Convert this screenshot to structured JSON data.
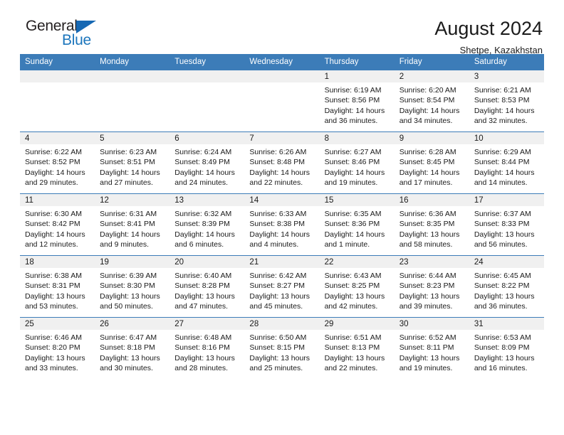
{
  "brand": {
    "name_part1": "General",
    "name_part2": "Blue",
    "triangle_color": "#1668b3",
    "blue_color": "#1b75bc"
  },
  "header": {
    "title": "August 2024",
    "subtitle": "Shetpe, Kazakhstan"
  },
  "theme": {
    "header_row_bg": "#3c7cb8",
    "daynum_band_bg": "#f0f0f0",
    "rule_color": "#3c7cb8"
  },
  "weekdays": [
    "Sunday",
    "Monday",
    "Tuesday",
    "Wednesday",
    "Thursday",
    "Friday",
    "Saturday"
  ],
  "weeks": [
    [
      {
        "day": "",
        "empty": true
      },
      {
        "day": "",
        "empty": true
      },
      {
        "day": "",
        "empty": true
      },
      {
        "day": "",
        "empty": true
      },
      {
        "day": "1",
        "sunrise": "Sunrise: 6:19 AM",
        "sunset": "Sunset: 8:56 PM",
        "daylight": "Daylight: 14 hours and 36 minutes."
      },
      {
        "day": "2",
        "sunrise": "Sunrise: 6:20 AM",
        "sunset": "Sunset: 8:54 PM",
        "daylight": "Daylight: 14 hours and 34 minutes."
      },
      {
        "day": "3",
        "sunrise": "Sunrise: 6:21 AM",
        "sunset": "Sunset: 8:53 PM",
        "daylight": "Daylight: 14 hours and 32 minutes."
      }
    ],
    [
      {
        "day": "4",
        "sunrise": "Sunrise: 6:22 AM",
        "sunset": "Sunset: 8:52 PM",
        "daylight": "Daylight: 14 hours and 29 minutes."
      },
      {
        "day": "5",
        "sunrise": "Sunrise: 6:23 AM",
        "sunset": "Sunset: 8:51 PM",
        "daylight": "Daylight: 14 hours and 27 minutes."
      },
      {
        "day": "6",
        "sunrise": "Sunrise: 6:24 AM",
        "sunset": "Sunset: 8:49 PM",
        "daylight": "Daylight: 14 hours and 24 minutes."
      },
      {
        "day": "7",
        "sunrise": "Sunrise: 6:26 AM",
        "sunset": "Sunset: 8:48 PM",
        "daylight": "Daylight: 14 hours and 22 minutes."
      },
      {
        "day": "8",
        "sunrise": "Sunrise: 6:27 AM",
        "sunset": "Sunset: 8:46 PM",
        "daylight": "Daylight: 14 hours and 19 minutes."
      },
      {
        "day": "9",
        "sunrise": "Sunrise: 6:28 AM",
        "sunset": "Sunset: 8:45 PM",
        "daylight": "Daylight: 14 hours and 17 minutes."
      },
      {
        "day": "10",
        "sunrise": "Sunrise: 6:29 AM",
        "sunset": "Sunset: 8:44 PM",
        "daylight": "Daylight: 14 hours and 14 minutes."
      }
    ],
    [
      {
        "day": "11",
        "sunrise": "Sunrise: 6:30 AM",
        "sunset": "Sunset: 8:42 PM",
        "daylight": "Daylight: 14 hours and 12 minutes."
      },
      {
        "day": "12",
        "sunrise": "Sunrise: 6:31 AM",
        "sunset": "Sunset: 8:41 PM",
        "daylight": "Daylight: 14 hours and 9 minutes."
      },
      {
        "day": "13",
        "sunrise": "Sunrise: 6:32 AM",
        "sunset": "Sunset: 8:39 PM",
        "daylight": "Daylight: 14 hours and 6 minutes."
      },
      {
        "day": "14",
        "sunrise": "Sunrise: 6:33 AM",
        "sunset": "Sunset: 8:38 PM",
        "daylight": "Daylight: 14 hours and 4 minutes."
      },
      {
        "day": "15",
        "sunrise": "Sunrise: 6:35 AM",
        "sunset": "Sunset: 8:36 PM",
        "daylight": "Daylight: 14 hours and 1 minute."
      },
      {
        "day": "16",
        "sunrise": "Sunrise: 6:36 AM",
        "sunset": "Sunset: 8:35 PM",
        "daylight": "Daylight: 13 hours and 58 minutes."
      },
      {
        "day": "17",
        "sunrise": "Sunrise: 6:37 AM",
        "sunset": "Sunset: 8:33 PM",
        "daylight": "Daylight: 13 hours and 56 minutes."
      }
    ],
    [
      {
        "day": "18",
        "sunrise": "Sunrise: 6:38 AM",
        "sunset": "Sunset: 8:31 PM",
        "daylight": "Daylight: 13 hours and 53 minutes."
      },
      {
        "day": "19",
        "sunrise": "Sunrise: 6:39 AM",
        "sunset": "Sunset: 8:30 PM",
        "daylight": "Daylight: 13 hours and 50 minutes."
      },
      {
        "day": "20",
        "sunrise": "Sunrise: 6:40 AM",
        "sunset": "Sunset: 8:28 PM",
        "daylight": "Daylight: 13 hours and 47 minutes."
      },
      {
        "day": "21",
        "sunrise": "Sunrise: 6:42 AM",
        "sunset": "Sunset: 8:27 PM",
        "daylight": "Daylight: 13 hours and 45 minutes."
      },
      {
        "day": "22",
        "sunrise": "Sunrise: 6:43 AM",
        "sunset": "Sunset: 8:25 PM",
        "daylight": "Daylight: 13 hours and 42 minutes."
      },
      {
        "day": "23",
        "sunrise": "Sunrise: 6:44 AM",
        "sunset": "Sunset: 8:23 PM",
        "daylight": "Daylight: 13 hours and 39 minutes."
      },
      {
        "day": "24",
        "sunrise": "Sunrise: 6:45 AM",
        "sunset": "Sunset: 8:22 PM",
        "daylight": "Daylight: 13 hours and 36 minutes."
      }
    ],
    [
      {
        "day": "25",
        "sunrise": "Sunrise: 6:46 AM",
        "sunset": "Sunset: 8:20 PM",
        "daylight": "Daylight: 13 hours and 33 minutes."
      },
      {
        "day": "26",
        "sunrise": "Sunrise: 6:47 AM",
        "sunset": "Sunset: 8:18 PM",
        "daylight": "Daylight: 13 hours and 30 minutes."
      },
      {
        "day": "27",
        "sunrise": "Sunrise: 6:48 AM",
        "sunset": "Sunset: 8:16 PM",
        "daylight": "Daylight: 13 hours and 28 minutes."
      },
      {
        "day": "28",
        "sunrise": "Sunrise: 6:50 AM",
        "sunset": "Sunset: 8:15 PM",
        "daylight": "Daylight: 13 hours and 25 minutes."
      },
      {
        "day": "29",
        "sunrise": "Sunrise: 6:51 AM",
        "sunset": "Sunset: 8:13 PM",
        "daylight": "Daylight: 13 hours and 22 minutes."
      },
      {
        "day": "30",
        "sunrise": "Sunrise: 6:52 AM",
        "sunset": "Sunset: 8:11 PM",
        "daylight": "Daylight: 13 hours and 19 minutes."
      },
      {
        "day": "31",
        "sunrise": "Sunrise: 6:53 AM",
        "sunset": "Sunset: 8:09 PM",
        "daylight": "Daylight: 13 hours and 16 minutes."
      }
    ]
  ]
}
